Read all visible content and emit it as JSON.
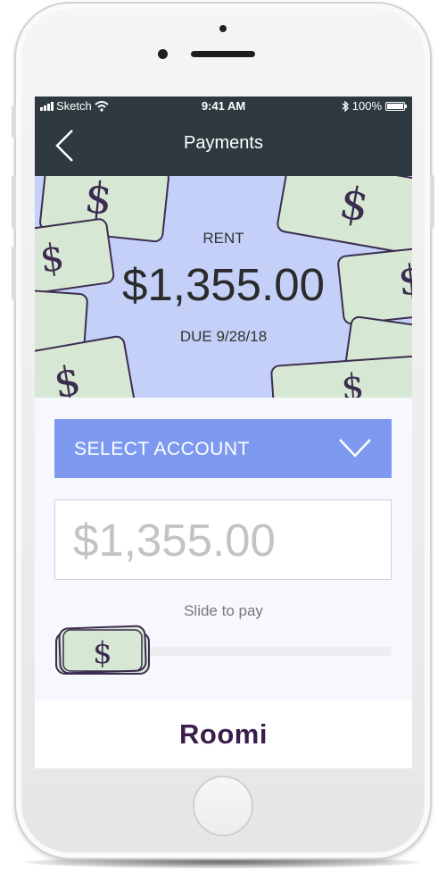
{
  "status_bar": {
    "carrier": "Sketch",
    "time": "9:41 AM",
    "battery": "100%"
  },
  "nav": {
    "title": "Payments"
  },
  "bill": {
    "label": "RENT",
    "amount": "$1,355.00",
    "due": "DUE 9/28/18",
    "money_symbol": "$"
  },
  "account_select": {
    "label": "SELECT ACCOUNT"
  },
  "payment_input": {
    "placeholder": "$1,355.00"
  },
  "slider": {
    "label": "Slide to pay",
    "progress": 0
  },
  "footer": {
    "brand": "Roomi"
  },
  "colors": {
    "nav_background": "#2f3a40",
    "hero_background": "#c4d0f7",
    "select_background": "#7d9af0",
    "bill_green": "#d6e8d4",
    "brand_purple": "#3b1c4a"
  }
}
